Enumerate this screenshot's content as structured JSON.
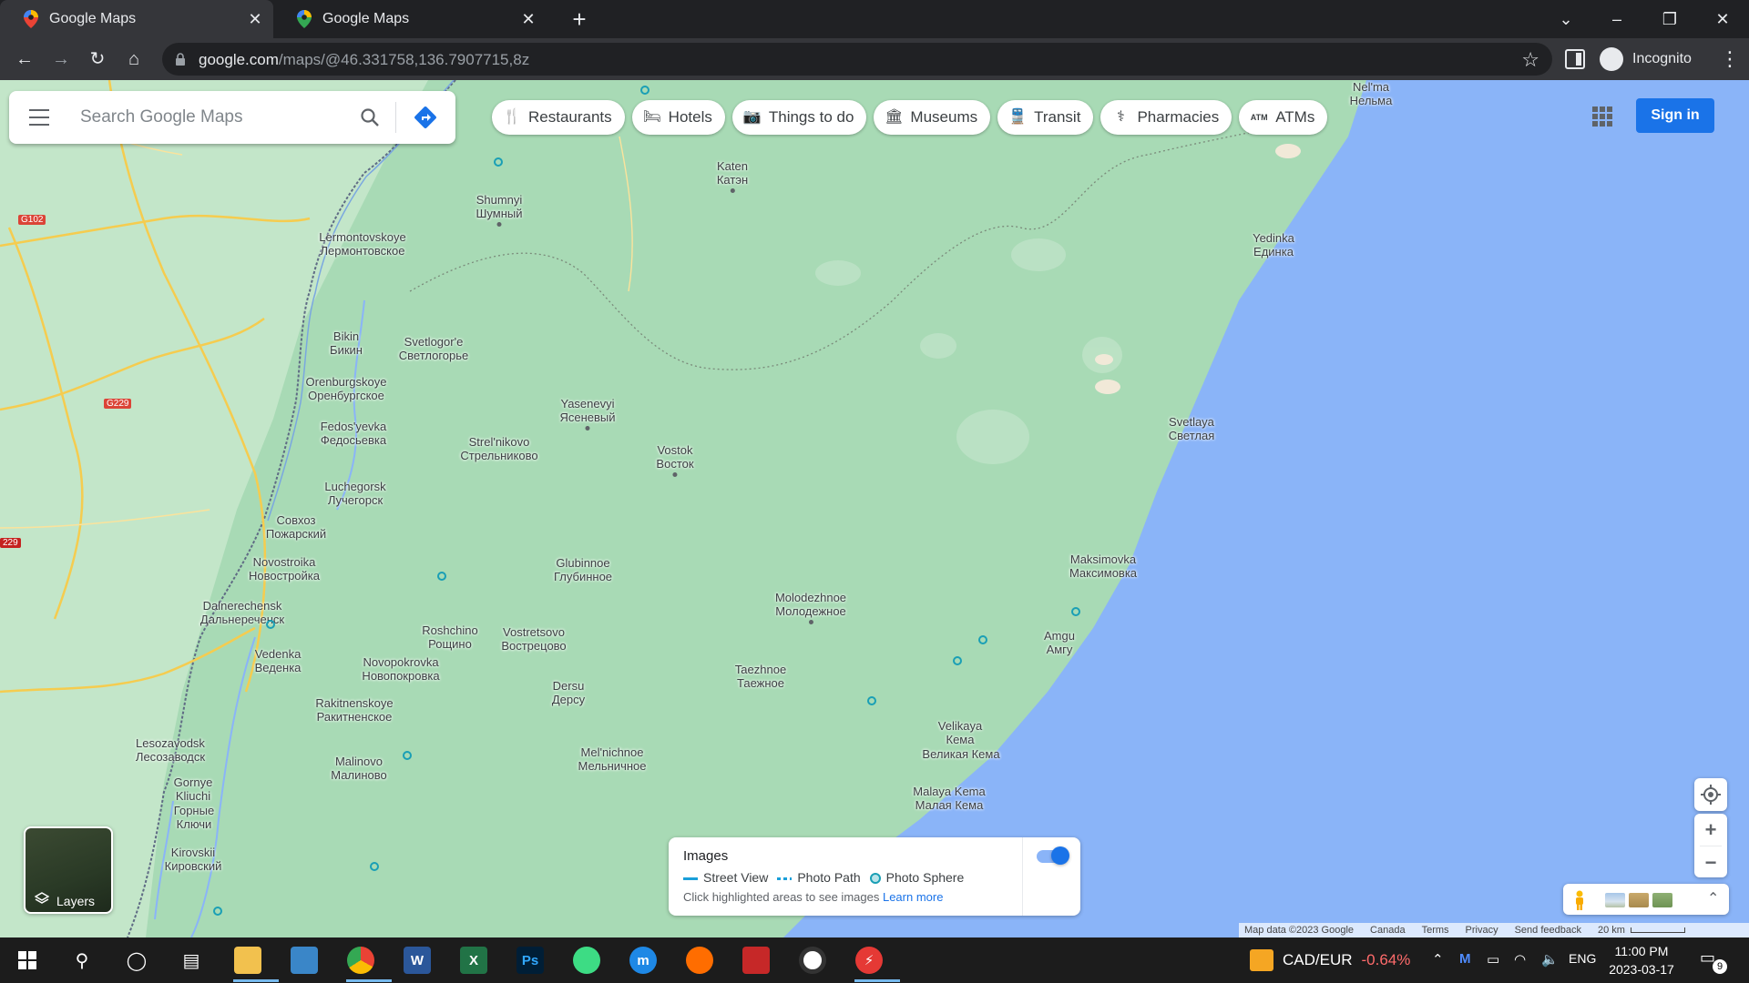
{
  "browser": {
    "tabs": [
      {
        "title": "Google Maps",
        "active": true
      },
      {
        "title": "Google Maps",
        "active": false
      }
    ],
    "url_host": "google.com",
    "url_path": "/maps/@46.331758,136.7907715,8z",
    "profile_label": "Incognito"
  },
  "map": {
    "search_placeholder": "Search Google Maps",
    "chips": [
      {
        "label": "Restaurants",
        "icon": "fork-knife-icon"
      },
      {
        "label": "Hotels",
        "icon": "bed-icon"
      },
      {
        "label": "Things to do",
        "icon": "camera-icon"
      },
      {
        "label": "Museums",
        "icon": "museum-icon"
      },
      {
        "label": "Transit",
        "icon": "train-icon"
      },
      {
        "label": "Pharmacies",
        "icon": "pharmacy-icon"
      },
      {
        "label": "ATMs",
        "icon": "atm-icon"
      }
    ],
    "signin_label": "Sign in",
    "layers_label": "Layers",
    "road_badges": [
      "G102",
      "G229",
      "229"
    ],
    "places": [
      {
        "name": "Nel'ma",
        "name_ru": "Нельма"
      },
      {
        "name": "Katen",
        "name_ru": "Катэн"
      },
      {
        "name": "Shumnyi",
        "name_ru": "Шумный"
      },
      {
        "name": "Lermontovskoye",
        "name_ru": "Лермонтовское"
      },
      {
        "name": "Yedinka",
        "name_ru": "Единка"
      },
      {
        "name": "Bikin",
        "name_ru": "Бикин"
      },
      {
        "name": "Svetlogor'e",
        "name_ru": "Светлогорье"
      },
      {
        "name": "Orenburgskoye",
        "name_ru": "Оренбургское"
      },
      {
        "name": "Yasenevyi",
        "name_ru": "Ясеневый"
      },
      {
        "name": "Fedos'yevka",
        "name_ru": "Федосьевка"
      },
      {
        "name": "Strel'nikovo",
        "name_ru": "Стрельниково"
      },
      {
        "name": "Vostok",
        "name_ru": "Восток"
      },
      {
        "name": "Svetlaya",
        "name_ru": "Светлая"
      },
      {
        "name": "Luchegorsk",
        "name_ru": "Лучегорск"
      },
      {
        "name": "Совхоз",
        "name_ru": "Пожарский"
      },
      {
        "name": "Novostroika",
        "name_ru": "Новостройка"
      },
      {
        "name": "Glubinnoe",
        "name_ru": "Глубинное"
      },
      {
        "name": "Maksimovka",
        "name_ru": "Максимовка"
      },
      {
        "name": "Dalnerechensk",
        "name_ru": "Дальнереченск"
      },
      {
        "name": "Molodezhnoe",
        "name_ru": "Молодежное"
      },
      {
        "name": "Roshchino",
        "name_ru": "Рощино"
      },
      {
        "name": "Vostretsovo",
        "name_ru": "Вострецово"
      },
      {
        "name": "Amgu",
        "name_ru": "Амгу"
      },
      {
        "name": "Vedenka",
        "name_ru": "Веденка"
      },
      {
        "name": "Novopokrovka",
        "name_ru": "Новопокровка"
      },
      {
        "name": "Taezhnoe",
        "name_ru": "Таежное"
      },
      {
        "name": "Dersu",
        "name_ru": "Дерсу"
      },
      {
        "name": "Rakitnenskoye",
        "name_ru": "Ракитненское"
      },
      {
        "name": "Velikaya",
        "name_ru": "Кема"
      },
      {
        "name": "Великая Кема",
        "name_ru": ""
      },
      {
        "name": "Lesozavodsk",
        "name_ru": "Лесозаводск"
      },
      {
        "name": "Mel'nichnoe",
        "name_ru": "Мельничное"
      },
      {
        "name": "Malinovo",
        "name_ru": "Малиново"
      },
      {
        "name": "Gornye",
        "name_ru": "Kliuchi"
      },
      {
        "name": "Горные",
        "name_ru": "Ключи"
      },
      {
        "name": "Malaya Kema",
        "name_ru": "Малая Кема"
      },
      {
        "name": "Kirovskii",
        "name_ru": "Кировский"
      }
    ],
    "images_panel": {
      "title": "Images",
      "street_view": "Street View",
      "photo_path": "Photo Path",
      "photo_sphere": "Photo Sphere",
      "hint": "Click highlighted areas to see images",
      "learn_more": "Learn more",
      "toggle_on": true
    },
    "attribution": {
      "data": "Map data ©2023 Google",
      "country": "Canada",
      "terms": "Terms",
      "privacy": "Privacy",
      "feedback": "Send feedback",
      "scale": "20 km"
    },
    "colors": {
      "land": "#a8dab5",
      "water": "#8ab4f8",
      "accent": "#1a73e8"
    }
  },
  "taskbar": {
    "stock_pair": "CAD/EUR",
    "stock_change": "-0.64%",
    "language": "ENG",
    "time": "11:00 PM",
    "date": "2023-03-17",
    "notification_count": "9"
  }
}
